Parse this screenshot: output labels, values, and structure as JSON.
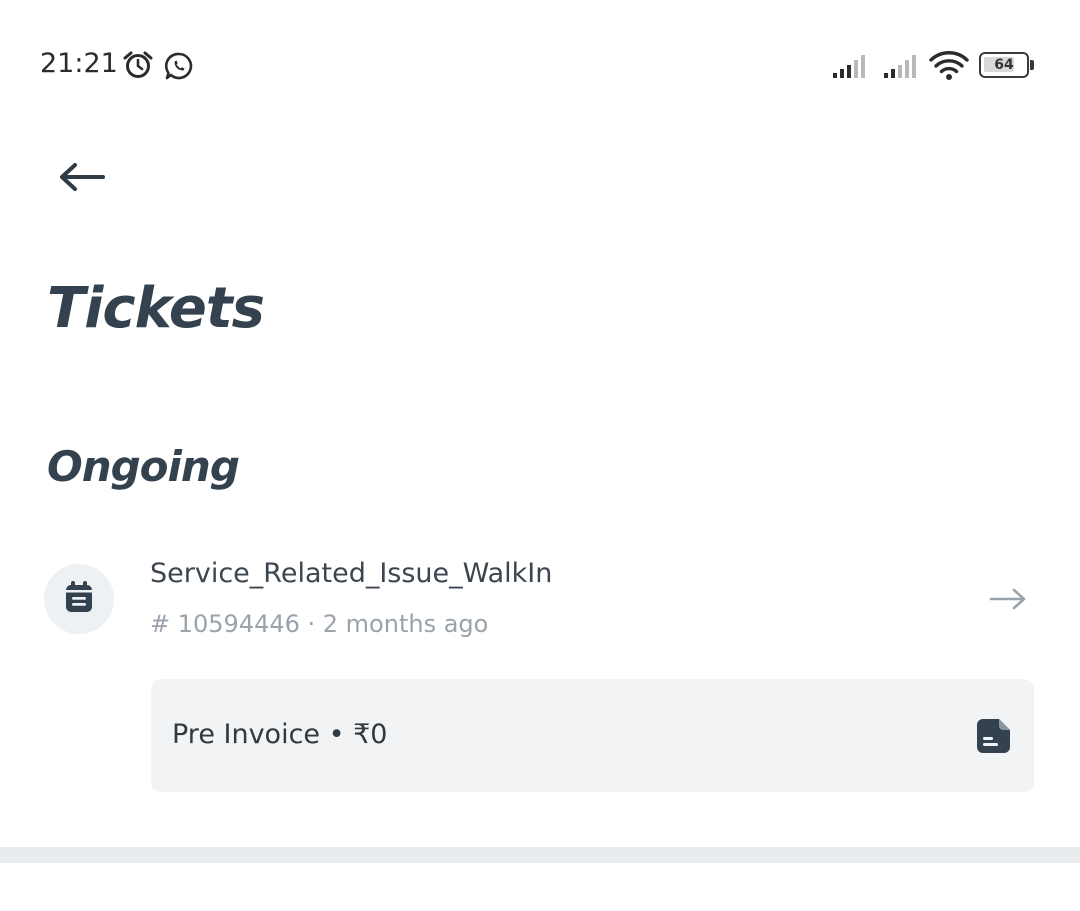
{
  "status_bar": {
    "time": "21:21",
    "battery_level": "64",
    "icons": [
      "alarm-icon",
      "whatsapp-icon",
      "signal-icon",
      "signal-icon",
      "wifi-icon",
      "battery-icon"
    ]
  },
  "header": {
    "back_icon": "arrow-left-icon",
    "title": "Tickets"
  },
  "sections": {
    "ongoing": {
      "title": "Ongoing",
      "tickets": [
        {
          "title": "Service_Related_Issue_WalkIn",
          "meta": "# 10594446 · 2 months ago",
          "icon": "calendar-icon",
          "invoice": {
            "label": "Pre Invoice • ₹0",
            "icon": "document-icon"
          }
        }
      ]
    }
  },
  "colors": {
    "title": "#33424e",
    "muted": "#9aa3ab",
    "card_bg": "#f2f3f5",
    "divider": "#e8ecef"
  }
}
